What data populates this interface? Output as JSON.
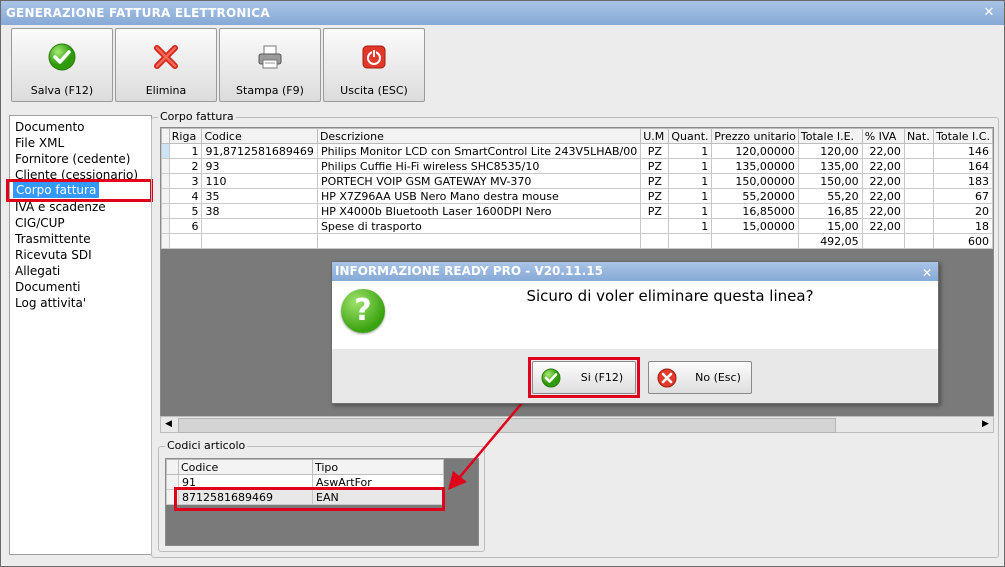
{
  "window": {
    "title": "GENERAZIONE FATTURA ELETTRONICA",
    "close_glyph": "✕"
  },
  "toolbar": {
    "save_label": "Salva (F12)",
    "delete_label": "Elimina",
    "print_label": "Stampa (F9)",
    "exit_label": "Uscita (ESC)",
    "save_icon": "check-icon",
    "delete_icon": "red-x-icon",
    "print_icon": "printer-icon",
    "exit_icon": "power-icon"
  },
  "nav": {
    "items": [
      "Documento",
      "File XML",
      "Fornitore (cedente)",
      "Cliente (cessionario)",
      "Corpo fattura",
      "IVA e scadenze",
      "CIG/CUP",
      "Trasmittente",
      "Ricevuta SDI",
      "Allegati",
      "Documenti",
      "Log attivita'"
    ],
    "selected": "Corpo fattura"
  },
  "corpo": {
    "group_title": "Corpo fattura",
    "headers": [
      "Riga",
      "Codice",
      "Descrizione",
      "U.M",
      "Quant.",
      "Prezzo unitario",
      "Totale I.E.",
      "% IVA",
      "Nat.",
      "Totale I.C."
    ],
    "rows": [
      [
        "1",
        "91,8712581689469",
        "Philips Monitor LCD con SmartControl Lite 243V5LHAB/00",
        "PZ",
        "1",
        "120,00000",
        "120,00",
        "22,00",
        "",
        "146"
      ],
      [
        "2",
        "93",
        "Philips Cuffie Hi-Fi wireless SHC8535/10",
        "PZ",
        "1",
        "135,00000",
        "135,00",
        "22,00",
        "",
        "164"
      ],
      [
        "3",
        "110",
        "PORTECH VOIP GSM GATEWAY MV-370",
        "PZ",
        "1",
        "150,00000",
        "150,00",
        "22,00",
        "",
        "183"
      ],
      [
        "4",
        "35",
        "HP X7Z96AA USB Nero Mano destra mouse",
        "PZ",
        "1",
        "55,20000",
        "55,20",
        "22,00",
        "",
        "67"
      ],
      [
        "5",
        "38",
        "HP X4000b Bluetooth Laser 1600DPI Nero",
        "PZ",
        "1",
        "16,85000",
        "16,85",
        "22,00",
        "",
        "20"
      ],
      [
        "6",
        "",
        "Spese di trasporto",
        "",
        "1",
        "15,00000",
        "15,00",
        "22,00",
        "",
        "18"
      ]
    ],
    "total_ie": "492,05",
    "total_ic": "600"
  },
  "codici": {
    "group_title": "Codici articolo",
    "headers": [
      "Codice",
      "Tipo"
    ],
    "rows": [
      [
        "91",
        "AswArtFor"
      ],
      [
        "8712581689469",
        "EAN"
      ]
    ]
  },
  "dialog": {
    "title": "INFORMAZIONE READY PRO - V20.11.15",
    "message": "Sicuro di voler eliminare questa linea?",
    "icon_glyph": "?",
    "yes_label": "Si (F12)",
    "no_label": "No (Esc)",
    "close_glyph": "✕"
  },
  "scroll": {
    "left": "◀",
    "right": "▶"
  },
  "annotation_color": "#e0001b"
}
